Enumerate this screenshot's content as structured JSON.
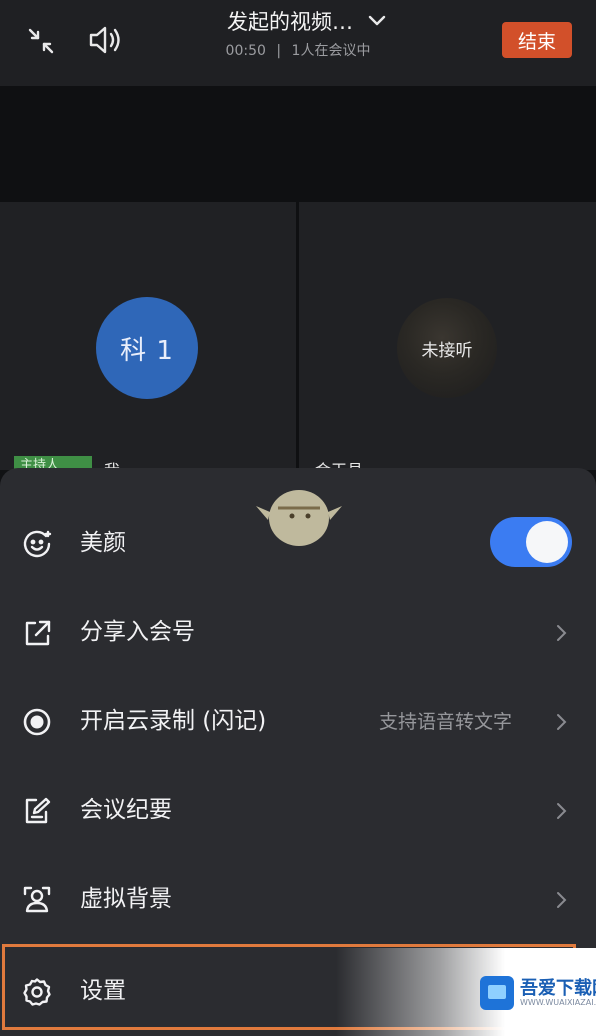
{
  "header": {
    "title": "发起的视频…",
    "duration": "00:50",
    "separator": "|",
    "participants": "1人在会议中",
    "end_label": "结束"
  },
  "icons": {
    "minimize": "collapse-arrows-icon",
    "speaker": "speaker-icon",
    "dropdown": "chevron-down-icon"
  },
  "tiles": [
    {
      "avatar_text": "科 1",
      "avatar_color": "#2f67b8",
      "badge": "主持人",
      "name": "我"
    },
    {
      "avatar_text": "未接听",
      "name": "金玉县"
    }
  ],
  "menu": {
    "items": [
      {
        "icon": "beauty-face-icon",
        "label": "美颜",
        "toggle_on": true
      },
      {
        "icon": "share-external-icon",
        "label": "分享入会号"
      },
      {
        "icon": "record-dot-icon",
        "label": "开启云录制 (闪记)",
        "hint": "支持语音转文字"
      },
      {
        "icon": "meeting-notes-icon",
        "label": "会议纪要"
      },
      {
        "icon": "virtual-background-icon",
        "label": "虚拟背景"
      },
      {
        "icon": "gear-icon",
        "label": "设置"
      }
    ]
  },
  "watermark": {
    "text": "吾爱下载网"
  },
  "colors": {
    "accent": "#3b7cf2",
    "end_button": "#d2502a",
    "highlight": "#e07a3d",
    "sheet_bg": "#2b2c30"
  }
}
